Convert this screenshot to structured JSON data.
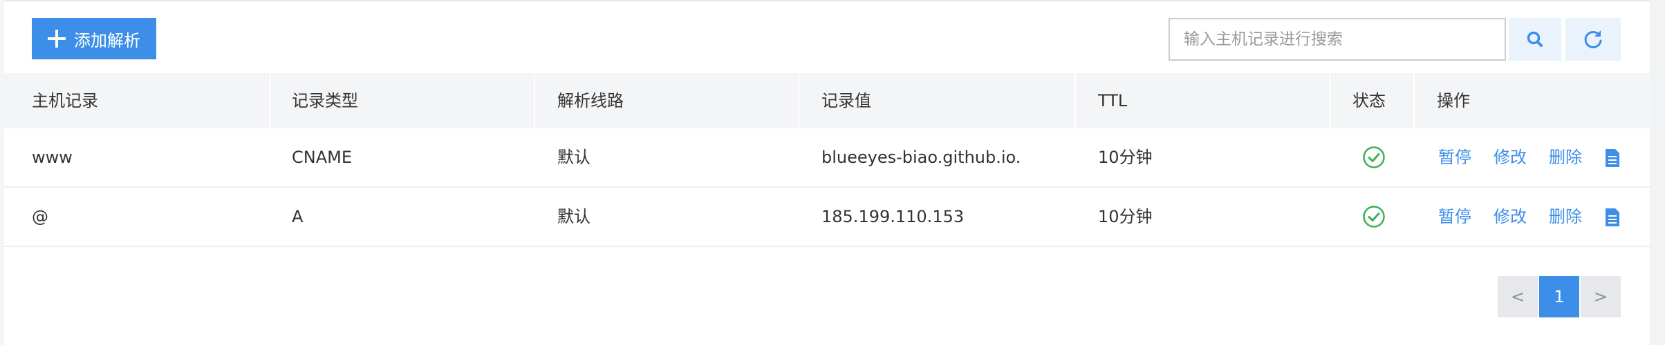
{
  "toolbar": {
    "add_label": "添加解析",
    "search_placeholder": "输入主机记录进行搜索",
    "search_value": ""
  },
  "columns": [
    "主机记录",
    "记录类型",
    "解析线路",
    "记录值",
    "TTL",
    "状态",
    "操作"
  ],
  "rows": [
    {
      "host": "www",
      "type": "CNAME",
      "line": "默认",
      "value": "blueeyes-biao.github.io.",
      "ttl": "10分钟",
      "status": "enabled"
    },
    {
      "host": "@",
      "type": "A",
      "line": "默认",
      "value": "185.199.110.153",
      "ttl": "10分钟",
      "status": "enabled"
    }
  ],
  "actions": {
    "pause": "暂停",
    "edit": "修改",
    "delete": "删除"
  },
  "pagination": {
    "prev": "<",
    "current": "1",
    "next": ">"
  },
  "colors": {
    "accent": "#3c8ee8",
    "status_ok": "#3fae5a"
  }
}
